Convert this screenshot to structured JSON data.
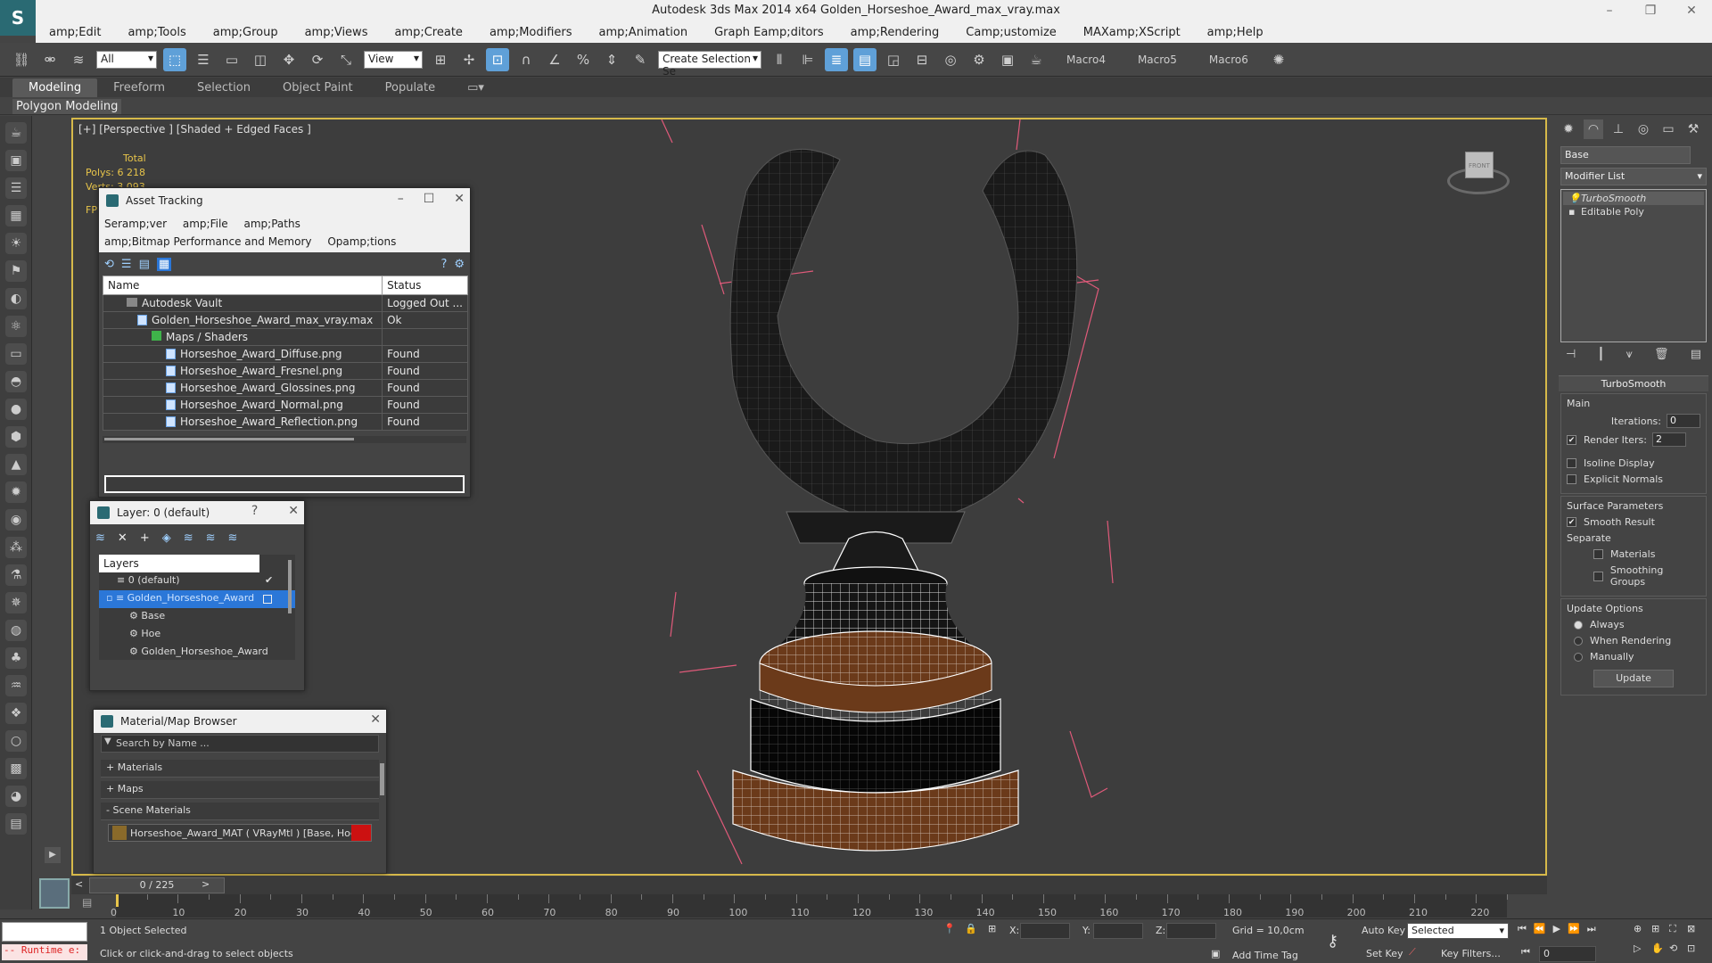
{
  "window": {
    "title": "Autodesk 3ds Max  2014 x64     Golden_Horseshoe_Award_max_vray.max",
    "logo": "S"
  },
  "menu": [
    "amp;Edit",
    "amp;Tools",
    "amp;Group",
    "amp;Views",
    "amp;Create",
    "amp;Modifiers",
    "amp;Animation",
    "Graph Eamp;ditors",
    "amp;Rendering",
    "Camp;ustomize",
    "MAXamp;XScript",
    "amp;Help"
  ],
  "toolbar": {
    "selection_filter": "All",
    "reference_coord": "View",
    "named_selection": "Create Selection Se",
    "macros": [
      "Macro4",
      "Macro5",
      "Macro6"
    ]
  },
  "ribbon": {
    "tabs": [
      "Modeling",
      "Freeform",
      "Selection",
      "Object Paint",
      "Populate"
    ],
    "panel_label": "Polygon Modeling"
  },
  "viewport": {
    "label": "[+] [Perspective ] [Shaded + Edged Faces ]",
    "stats_total": "Total",
    "polys_label": "Polys:",
    "polys_value": "6 218",
    "verts_label": "Verts:",
    "verts_value": "3 093",
    "fps_label": "FP",
    "viewcube_label": "FRONT"
  },
  "asset_tracking": {
    "title": "Asset Tracking",
    "menu1": [
      "Seramp;ver",
      "amp;File",
      "amp;Paths"
    ],
    "menu2": [
      "amp;Bitmap Performance and Memory",
      "Opamp;tions"
    ],
    "columns": [
      "Name",
      "Status"
    ],
    "rows": [
      {
        "name": "Autodesk Vault",
        "status": "Logged Out ..."
      },
      {
        "name": "Golden_Horseshoe_Award_max_vray.max",
        "status": "Ok"
      },
      {
        "name": "Maps / Shaders",
        "status": ""
      },
      {
        "name": "Horseshoe_Award_Diffuse.png",
        "status": "Found"
      },
      {
        "name": "Horseshoe_Award_Fresnel.png",
        "status": "Found"
      },
      {
        "name": "Horseshoe_Award_Glossines.png",
        "status": "Found"
      },
      {
        "name": "Horseshoe_Award_Normal.png",
        "status": "Found"
      },
      {
        "name": "Horseshoe_Award_Reflection.png",
        "status": "Found"
      }
    ]
  },
  "layer_window": {
    "title": "Layer: 0 (default)",
    "help": "?",
    "header": "Layers",
    "rows": [
      "0 (default)",
      "Golden_Horseshoe_Award",
      "Base",
      "Hoe",
      "Golden_Horseshoe_Award"
    ]
  },
  "material_browser": {
    "title": "Material/Map Browser",
    "search_placeholder": "Search by Name ...",
    "sections": [
      "+ Materials",
      "+ Maps",
      "- Scene Materials"
    ],
    "material": "Horseshoe_Award_MAT  ( VRayMtl )  [Base, Hoe]"
  },
  "command_panel": {
    "object_name": "Base",
    "modifier_list": "Modifier List",
    "stack": [
      "TurboSmooth",
      "Editable Poly"
    ],
    "rollout_title": "TurboSmooth",
    "main_label": "Main",
    "iterations_label": "Iterations:",
    "iterations_value": "0",
    "render_iters_label": "Render Iters:",
    "render_iters_value": "2",
    "isoline_label": "Isoline Display",
    "explicit_normals_label": "Explicit Normals",
    "surface_params_label": "Surface Parameters",
    "smooth_result_label": "Smooth Result",
    "separate_label": "Separate",
    "materials_label": "Materials",
    "smoothing_groups_label": "Smoothing Groups",
    "update_options_label": "Update Options",
    "always_label": "Always",
    "when_rendering_label": "When Rendering",
    "manually_label": "Manually",
    "update_button": "Update"
  },
  "timeline": {
    "frame_display": "0 / 225",
    "ticks": [
      "0",
      "10",
      "20",
      "30",
      "40",
      "50",
      "60",
      "70",
      "80",
      "90",
      "100",
      "110",
      "120",
      "130",
      "140",
      "150",
      "160",
      "170",
      "180",
      "190",
      "200",
      "210",
      "220"
    ]
  },
  "status": {
    "selected": "1 Object Selected",
    "prompt": "Click or click-and-drag to select objects",
    "runtime": "-- Runtime e:",
    "x_label": "X:",
    "y_label": "Y:",
    "z_label": "Z:",
    "grid": "Grid = 10,0cm",
    "auto_key": "Auto Key",
    "key_mode": "Selected",
    "set_key": "Set Key",
    "key_filters": "Key Filters...",
    "add_time_tag": "Add Time Tag",
    "frame_field": "0"
  },
  "colors": {
    "viewport_border": "#d6b94a",
    "selection_blue": "#2b77d8",
    "stats_yellow": "#e7c44a",
    "wire_white": "#ffffff",
    "bronze": "#6b3a1a",
    "gizmo_pink": "#e05a7a"
  }
}
